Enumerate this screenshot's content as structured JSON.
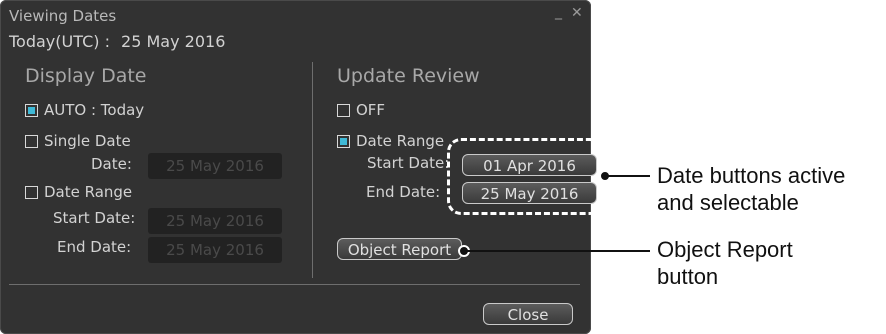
{
  "dialog": {
    "title": "Viewing Dates",
    "minimize": "_",
    "close_glyph": "✕",
    "today_label": "Today(UTC) :",
    "today_value": "25 May 2016"
  },
  "display_date": {
    "title": "Display Date",
    "auto_label": "AUTO : Today",
    "auto_checked": true,
    "single_label": "Single Date",
    "single_checked": false,
    "date_label": "Date:",
    "date_value": "25 May 2016",
    "range_label": "Date Range",
    "range_checked": false,
    "start_label": "Start Date:",
    "start_value": "25 May 2016",
    "end_label": "End  Date:",
    "end_value": "25 May 2016"
  },
  "update_review": {
    "title": "Update Review",
    "off_label": "OFF",
    "off_checked": false,
    "range_label": "Date Range",
    "range_checked": true,
    "start_label": "Start Date:",
    "start_value": "01 Apr 2016",
    "end_label": "End  Date:",
    "end_value": "25 May 2016",
    "object_report_label": "Object Report"
  },
  "footer": {
    "close_label": "Close"
  },
  "callouts": {
    "date_buttons_line1": "Date buttons active",
    "date_buttons_line2": "and selectable",
    "object_report_line1": "Object Report",
    "object_report_line2": "button"
  },
  "colors": {
    "accent": "#3fb9d6",
    "panel": "#323232",
    "field_disabled": "#222222"
  }
}
